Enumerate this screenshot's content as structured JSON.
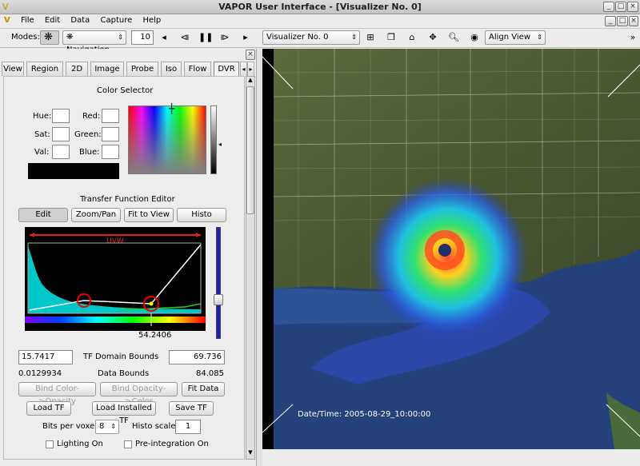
{
  "window": {
    "title": "VAPOR User Interface - [Visualizer No. 0]"
  },
  "menu": [
    "File",
    "Edit",
    "Data",
    "Capture",
    "Help"
  ],
  "toolbar": {
    "modes_label": "Modes:",
    "mode_value": "Navigation",
    "frame_value": "10",
    "visualizer_value": "Visualizer No. 0",
    "align_value": "Align View"
  },
  "tabs": [
    "View",
    "Region",
    "2D",
    "Image",
    "Probe",
    "Iso",
    "Flow",
    "DVR"
  ],
  "active_tab": "DVR",
  "color_selector": {
    "title": "Color Selector",
    "hue_label": "Hue:",
    "sat_label": "Sat:",
    "val_label": "Val:",
    "red_label": "Red:",
    "green_label": "Green:",
    "blue_label": "Blue:"
  },
  "tf_editor": {
    "title": "Transfer Function Editor",
    "edit": "Edit",
    "zoom_pan": "Zoom/Pan",
    "fit_to_view": "Fit to View",
    "histo": "Histo",
    "variable": "UVW",
    "cursor_value": "54.2406",
    "domain_min": "15.7417",
    "domain_label": "TF Domain Bounds",
    "domain_max": "69.736",
    "data_min": "0.0129934",
    "data_label": "Data Bounds",
    "data_max": "84.085",
    "bind_color_opacity": "Bind Color->Opacity",
    "bind_opacity_color": "Bind Opacity->Color",
    "fit_data": "Fit Data",
    "load_tf": "Load TF",
    "load_installed_tf": "Load Installed TF",
    "save_tf": "Save TF",
    "bits_label": "Bits per voxel",
    "bits_value": "8",
    "histo_scale_label": "Histo scale",
    "histo_scale_value": "1",
    "lighting_label": "Lighting On",
    "preint_label": "Pre-integration On"
  },
  "visualizer": {
    "datetime": "Date/Time: 2005-08-29_10:00:00"
  }
}
